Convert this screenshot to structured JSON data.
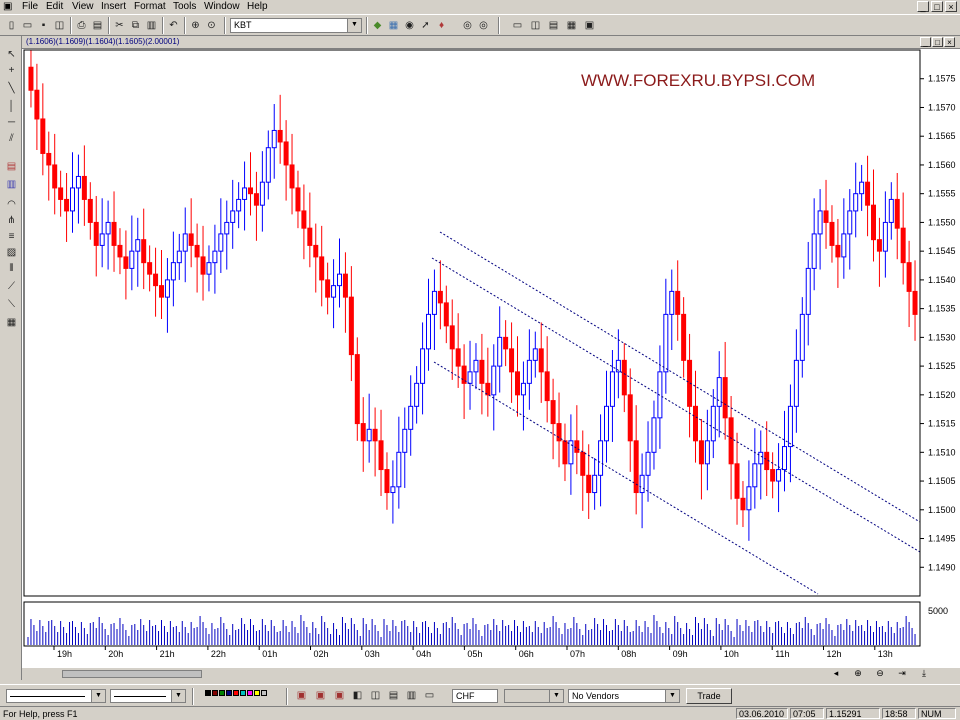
{
  "menu": [
    "File",
    "Edit",
    "View",
    "Insert",
    "Format",
    "Tools",
    "Window",
    "Help"
  ],
  "window_controls": [
    "_",
    "□",
    "×"
  ],
  "toolbar": {
    "symbol_value": "KBT",
    "icons": [
      "new-icon",
      "open-icon",
      "save-icon",
      "print-preview-icon",
      "print-icon",
      "cut-icon",
      "copy-icon",
      "paste-icon",
      "undo-icon",
      "crosshair-icon",
      "zoom-icon",
      "book-icon",
      "chart-icon",
      "alert-icon",
      "binoculars-icon",
      "cursor-icon",
      "layout-icon",
      "tile-icon",
      "cascade-icon",
      "grid-icon"
    ]
  },
  "chart_title": "(1.1606)(1.1609)(1.1604)(1.1605)(2.00001)",
  "watermark": "WWW.FOREXRU.BYPSI.COM",
  "chart_data": {
    "type": "candlestick",
    "timeframe_hint": "intraday",
    "ylim": [
      1.1485,
      1.158
    ],
    "yticks": [
      "1.1575",
      "1.1570",
      "1.1565",
      "1.1560",
      "1.1555",
      "1.1550",
      "1.1545",
      "1.1540",
      "1.1535",
      "1.1530",
      "1.1525",
      "1.1520",
      "1.1515",
      "1.1510",
      "1.1505",
      "1.1500",
      "1.1495",
      "1.1490"
    ],
    "xticks": [
      "19h",
      "20h",
      "21h",
      "22h",
      "01h",
      "02h",
      "03h",
      "04h",
      "05h",
      "06h",
      "07h",
      "08h",
      "09h",
      "10h",
      "11h",
      "12h",
      "13h"
    ],
    "volume_label": "5000",
    "colors": {
      "up": "#0000ff",
      "down": "#ff0000",
      "channel": "#000080"
    },
    "closes": [
      1.1573,
      1.1568,
      1.1562,
      1.156,
      1.1556,
      1.1554,
      1.1552,
      1.1556,
      1.1558,
      1.1554,
      1.155,
      1.1546,
      1.1548,
      1.155,
      1.1546,
      1.1544,
      1.1542,
      1.1545,
      1.1547,
      1.1543,
      1.1541,
      1.1539,
      1.1537,
      1.154,
      1.1543,
      1.1545,
      1.1548,
      1.1546,
      1.1544,
      1.1541,
      1.1543,
      1.1545,
      1.1548,
      1.155,
      1.1552,
      1.1554,
      1.1556,
      1.1555,
      1.1553,
      1.1557,
      1.1563,
      1.1566,
      1.1564,
      1.156,
      1.1556,
      1.1552,
      1.1549,
      1.1546,
      1.1544,
      1.154,
      1.1537,
      1.1539,
      1.1541,
      1.1537,
      1.1527,
      1.1515,
      1.1512,
      1.1514,
      1.1512,
      1.1507,
      1.1503,
      1.1504,
      1.151,
      1.1514,
      1.1518,
      1.1522,
      1.1528,
      1.1534,
      1.1538,
      1.1536,
      1.1532,
      1.1528,
      1.1525,
      1.1522,
      1.1524,
      1.1526,
      1.1522,
      1.152,
      1.1525,
      1.153,
      1.1528,
      1.1524,
      1.152,
      1.1522,
      1.1526,
      1.1528,
      1.1524,
      1.1519,
      1.1515,
      1.1512,
      1.1508,
      1.1512,
      1.151,
      1.1506,
      1.1503,
      1.1506,
      1.1512,
      1.1518,
      1.1524,
      1.1526,
      1.152,
      1.1512,
      1.1503,
      1.1506,
      1.151,
      1.1516,
      1.1524,
      1.1534,
      1.1538,
      1.1534,
      1.1526,
      1.1518,
      1.1512,
      1.1508,
      1.1512,
      1.1518,
      1.1523,
      1.1516,
      1.1508,
      1.1502,
      1.15,
      1.1504,
      1.1508,
      1.151,
      1.1507,
      1.1505,
      1.1507,
      1.1511,
      1.1518,
      1.1526,
      1.1534,
      1.1542,
      1.1548,
      1.1552,
      1.155,
      1.1546,
      1.1544,
      1.1548,
      1.1552,
      1.1555,
      1.1557,
      1.1553,
      1.1547,
      1.1545,
      1.155,
      1.1554,
      1.1549,
      1.1543,
      1.1538,
      1.1534
    ]
  },
  "bottombar": {
    "combo_values": [
      "CHF",
      "",
      "No Vendors"
    ],
    "trade_label": "Trade"
  },
  "status": {
    "help": "For Help, press F1",
    "date": "03.06.2010",
    "time": "07:05",
    "price": "1.15291",
    "clock": "18:58",
    "num": "NUM"
  }
}
